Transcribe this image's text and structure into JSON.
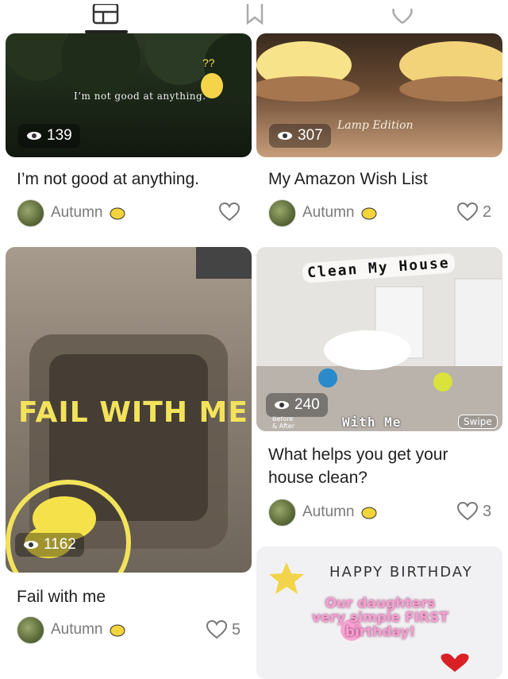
{
  "tabs": [
    {
      "name": "tab-grid",
      "icon": "layout-icon"
    },
    {
      "name": "tab-saved",
      "icon": "bookmark-icon"
    },
    {
      "name": "tab-liked",
      "icon": "heart-icon"
    }
  ],
  "posts": [
    {
      "title": "I’m not good at anything.",
      "views": "139",
      "overlay_text": "I’m not good at anything.",
      "author": "Autumn",
      "likes": ""
    },
    {
      "title": "My Amazon Wish List",
      "views": "307",
      "overlay_text": "Lamp Edition",
      "author": "Autumn",
      "likes": "2"
    },
    {
      "title": "Fail with me",
      "views": "1162",
      "overlay_text": "FAIL WITH ME",
      "author": "Autumn",
      "likes": "5"
    },
    {
      "title_line1": "What helps you get your",
      "title_line2": "house clean?",
      "views": "240",
      "overlay_title": "Clean My House",
      "overlay_sub": "With Me",
      "overlay_tag": "Swipe",
      "overlay_small": "Before & After",
      "author": "Autumn",
      "likes": "3"
    },
    {
      "overlay_top": "HAPPY BIRTHDAY",
      "overlay_line1": "Our daughters",
      "overlay_line2": "very simple FIRST",
      "overlay_line3": "birthday!"
    }
  ],
  "colors": {
    "accent_yellow": "#f2e35b",
    "text_dark": "#1f1f1f",
    "text_muted": "#7a7a7a"
  }
}
